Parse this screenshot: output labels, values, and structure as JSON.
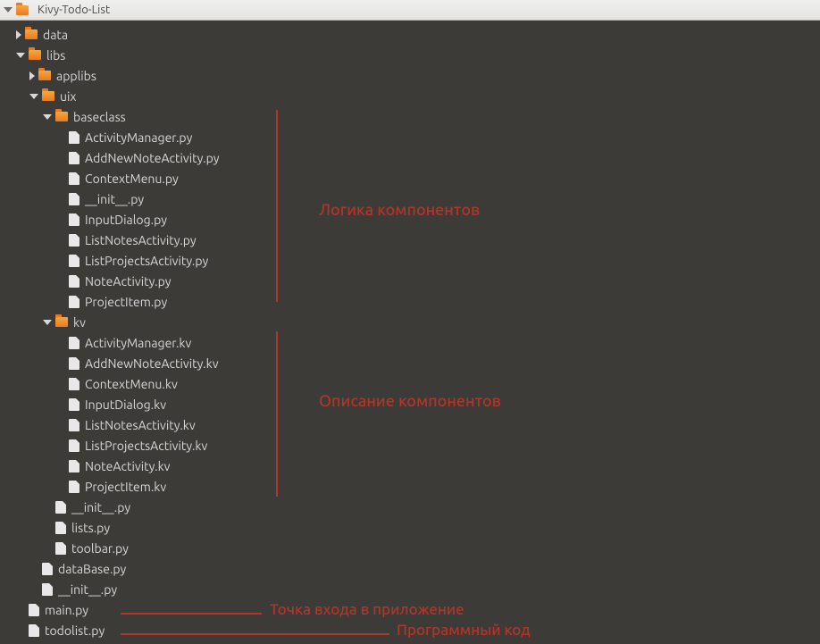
{
  "title": "Kivy-Todo-List",
  "rows": [
    {
      "indent": 1,
      "toggle": "right",
      "icon": "folder",
      "label": "data"
    },
    {
      "indent": 1,
      "toggle": "down",
      "icon": "folder",
      "label": "libs"
    },
    {
      "indent": 2,
      "toggle": "right",
      "icon": "folder",
      "label": "applibs"
    },
    {
      "indent": 2,
      "toggle": "down",
      "icon": "folder",
      "label": "uix"
    },
    {
      "indent": 3,
      "toggle": "down",
      "icon": "folder",
      "label": "baseclass"
    },
    {
      "indent": 4,
      "toggle": "none",
      "icon": "file",
      "label": "ActivityManager.py"
    },
    {
      "indent": 4,
      "toggle": "none",
      "icon": "file",
      "label": "AddNewNoteActivity.py"
    },
    {
      "indent": 4,
      "toggle": "none",
      "icon": "file",
      "label": "ContextMenu.py"
    },
    {
      "indent": 4,
      "toggle": "none",
      "icon": "file",
      "label": "__init__.py"
    },
    {
      "indent": 4,
      "toggle": "none",
      "icon": "file",
      "label": "InputDialog.py"
    },
    {
      "indent": 4,
      "toggle": "none",
      "icon": "file",
      "label": "ListNotesActivity.py"
    },
    {
      "indent": 4,
      "toggle": "none",
      "icon": "file",
      "label": "ListProjectsActivity.py"
    },
    {
      "indent": 4,
      "toggle": "none",
      "icon": "file",
      "label": "NoteActivity.py"
    },
    {
      "indent": 4,
      "toggle": "none",
      "icon": "file",
      "label": "ProjectItem.py"
    },
    {
      "indent": 3,
      "toggle": "down",
      "icon": "folder",
      "label": "kv"
    },
    {
      "indent": 4,
      "toggle": "none",
      "icon": "file",
      "label": "ActivityManager.kv"
    },
    {
      "indent": 4,
      "toggle": "none",
      "icon": "file",
      "label": "AddNewNoteActivity.kv"
    },
    {
      "indent": 4,
      "toggle": "none",
      "icon": "file",
      "label": "ContextMenu.kv"
    },
    {
      "indent": 4,
      "toggle": "none",
      "icon": "file",
      "label": "InputDialog.kv"
    },
    {
      "indent": 4,
      "toggle": "none",
      "icon": "file",
      "label": "ListNotesActivity.kv"
    },
    {
      "indent": 4,
      "toggle": "none",
      "icon": "file",
      "label": "ListProjectsActivity.kv"
    },
    {
      "indent": 4,
      "toggle": "none",
      "icon": "file",
      "label": "NoteActivity.kv"
    },
    {
      "indent": 4,
      "toggle": "none",
      "icon": "file",
      "label": "ProjectItem.kv"
    },
    {
      "indent": 3,
      "toggle": "none",
      "icon": "file",
      "label": "__init__.py"
    },
    {
      "indent": 3,
      "toggle": "none",
      "icon": "file",
      "label": "lists.py"
    },
    {
      "indent": 3,
      "toggle": "none",
      "icon": "file",
      "label": "toolbar.py"
    },
    {
      "indent": 2,
      "toggle": "none",
      "icon": "file",
      "label": "dataBase.py"
    },
    {
      "indent": 2,
      "toggle": "none",
      "icon": "file",
      "label": "__init__.py"
    },
    {
      "indent": 1,
      "toggle": "none",
      "icon": "file",
      "label": "main.py"
    },
    {
      "indent": 1,
      "toggle": "none",
      "icon": "file",
      "label": "todolist.py"
    }
  ],
  "annotations": {
    "logic": "Логика компонентов",
    "description": "Описание компонентов",
    "entry": "Точка входа в приложение",
    "code": "Программный код"
  },
  "colors": {
    "accent": "#b33529",
    "bg": "#3c3b37",
    "fg": "#d8d8d8",
    "folder": "#e97b1e"
  }
}
